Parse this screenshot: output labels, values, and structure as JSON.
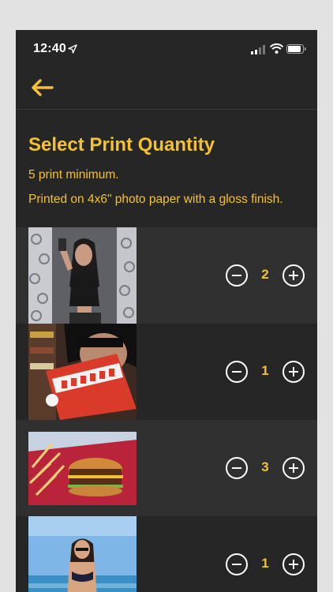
{
  "status_bar": {
    "time": "12:40"
  },
  "nav": {
    "back_icon": "arrow-left-icon"
  },
  "header": {
    "title": "Select Print Quantity",
    "min_note": "5 print minimum.",
    "paper_note": "Printed on 4x6\" photo paper with a gloss finish."
  },
  "colors": {
    "accent": "#f5c22d",
    "background": "#262626",
    "row_alt": "#303030"
  },
  "prints": [
    {
      "quantity": "2"
    },
    {
      "quantity": "1"
    },
    {
      "quantity": "3"
    },
    {
      "quantity": "1"
    }
  ]
}
